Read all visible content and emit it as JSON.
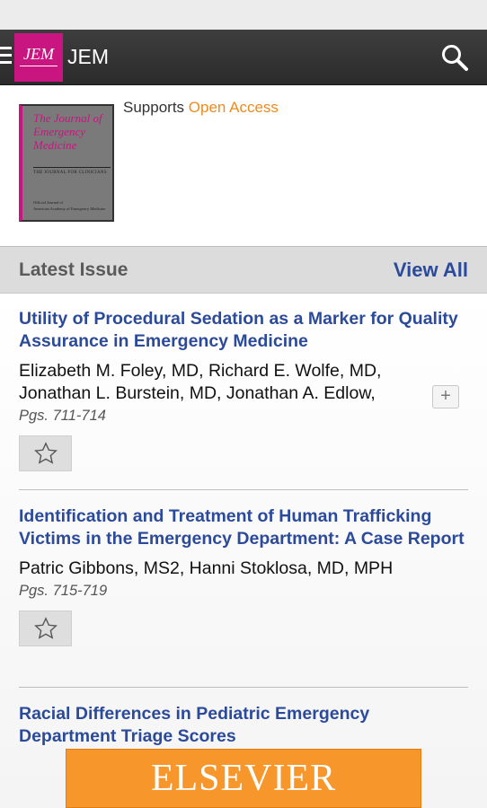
{
  "app_bar": {
    "logo_text": "JEM",
    "title": "JEM"
  },
  "journal": {
    "cover": {
      "title": "The Journal of Emergency Medicine",
      "subtitle": "THE JOURNAL FOR CLINICIANS",
      "footer_line1": "Official Journal of",
      "footer_line2": "American Academy of Emergency Medicine"
    },
    "supports_prefix": "Supports ",
    "supports_link": "Open Access"
  },
  "section": {
    "heading": "Latest Issue",
    "view_all": "View All"
  },
  "articles": [
    {
      "title": "Utility of Procedural Sedation as a Marker for Quality Assurance in Emergency Medicine",
      "authors": "Elizabeth M. Foley, MD, Richard E. Wolfe, MD, Jonathan L. Burstein, MD, Jonathan A. Edlow,",
      "pages": "Pgs. 711-714",
      "expand": "+"
    },
    {
      "title": "Identification and Treatment of Human Trafficking Victims in the Emergency Department: A Case Report",
      "authors": "Patric Gibbons, MS2, Hanni Stoklosa, MD, MPH",
      "pages": "Pgs. 715-719"
    },
    {
      "title": "Racial Differences in Pediatric Emergency Department Triage Scores"
    }
  ],
  "ad": {
    "text": "ELSEVIER"
  }
}
